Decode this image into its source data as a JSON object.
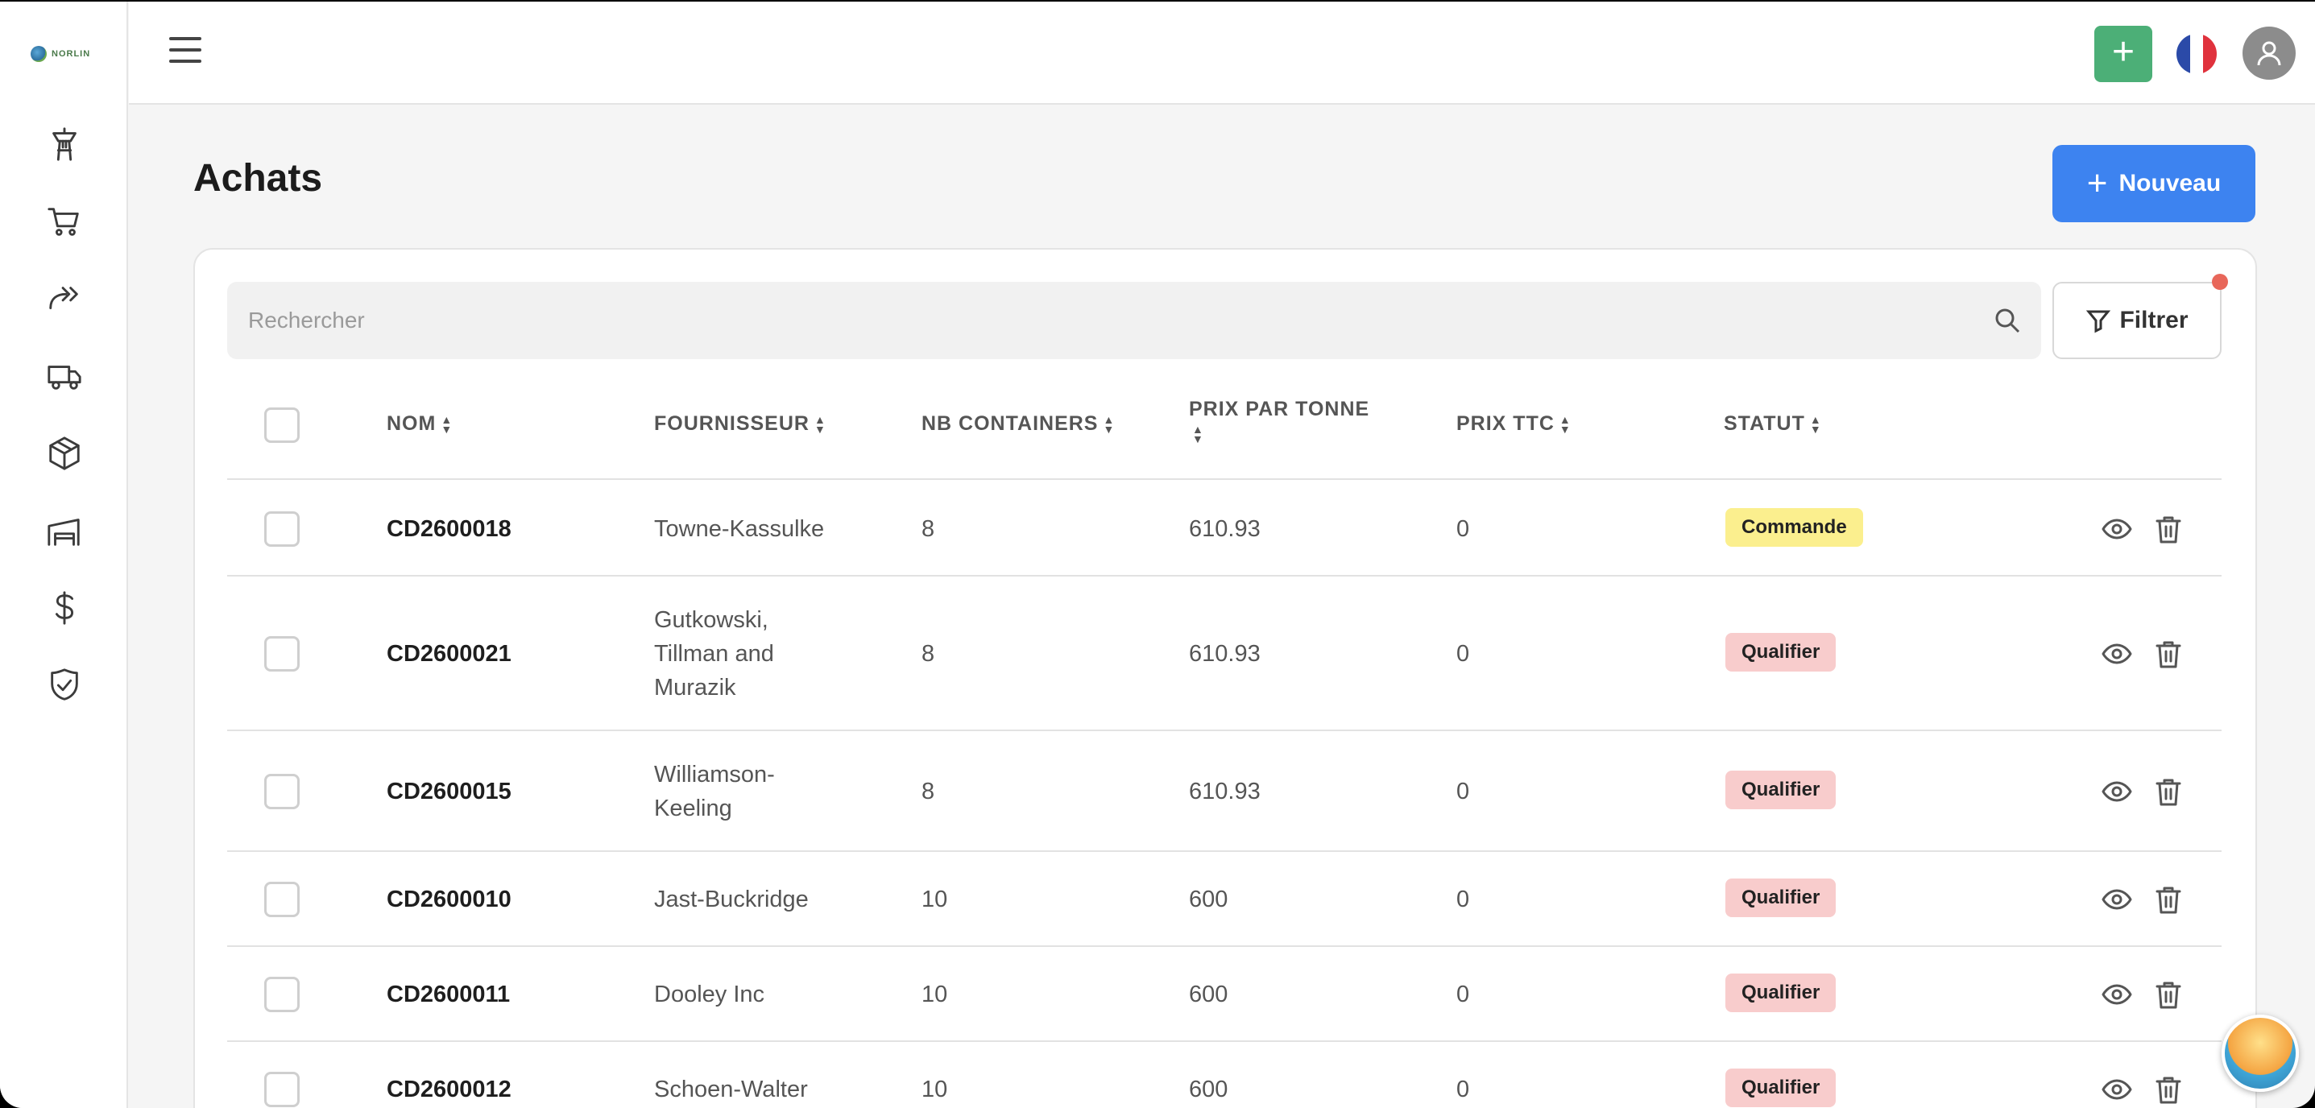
{
  "app": {
    "logo_text": "NORLIN"
  },
  "sidebar": {
    "items": [
      {
        "icon": "control-tower-icon"
      },
      {
        "icon": "cart-icon"
      },
      {
        "icon": "forward-icon"
      },
      {
        "icon": "truck-icon"
      },
      {
        "icon": "package-icon"
      },
      {
        "icon": "warehouse-icon"
      },
      {
        "icon": "dollar-icon"
      },
      {
        "icon": "shield-check-icon"
      }
    ]
  },
  "header": {
    "add_label": "+"
  },
  "page": {
    "title": "Achats",
    "new_button": "Nouveau"
  },
  "search": {
    "placeholder": "Rechercher"
  },
  "filter": {
    "label": "Filtrer"
  },
  "table": {
    "columns": [
      "NOM",
      "FOURNISSEUR",
      "NB CONTAINERS",
      "PRIX PAR TONNE",
      "PRIX TTC",
      "STATUT"
    ],
    "rows": [
      {
        "nom": "CD2600018",
        "fournisseur": [
          "Towne-Kassulke"
        ],
        "containers": "8",
        "prix_tonne": "610.93",
        "prix_ttc": "0",
        "statut": "Commande"
      },
      {
        "nom": "CD2600021",
        "fournisseur": [
          "Gutkowski,",
          "Tillman and",
          "Murazik"
        ],
        "containers": "8",
        "prix_tonne": "610.93",
        "prix_ttc": "0",
        "statut": "Qualifier"
      },
      {
        "nom": "CD2600015",
        "fournisseur": [
          "Williamson-",
          "Keeling"
        ],
        "containers": "8",
        "prix_tonne": "610.93",
        "prix_ttc": "0",
        "statut": "Qualifier"
      },
      {
        "nom": "CD2600010",
        "fournisseur": [
          "Jast-Buckridge"
        ],
        "containers": "10",
        "prix_tonne": "600",
        "prix_ttc": "0",
        "statut": "Qualifier"
      },
      {
        "nom": "CD2600011",
        "fournisseur": [
          "Dooley Inc"
        ],
        "containers": "10",
        "prix_tonne": "600",
        "prix_ttc": "0",
        "statut": "Qualifier"
      },
      {
        "nom": "CD2600012",
        "fournisseur": [
          "Schoen-Walter"
        ],
        "containers": "10",
        "prix_tonne": "600",
        "prix_ttc": "0",
        "statut": "Qualifier"
      }
    ]
  },
  "colors": {
    "primary": "#3d83f0",
    "success": "#4caf77",
    "badge_commande": "#fbef8e",
    "badge_qualifier": "#f8cccc",
    "filter_dot": "#e8675a"
  }
}
